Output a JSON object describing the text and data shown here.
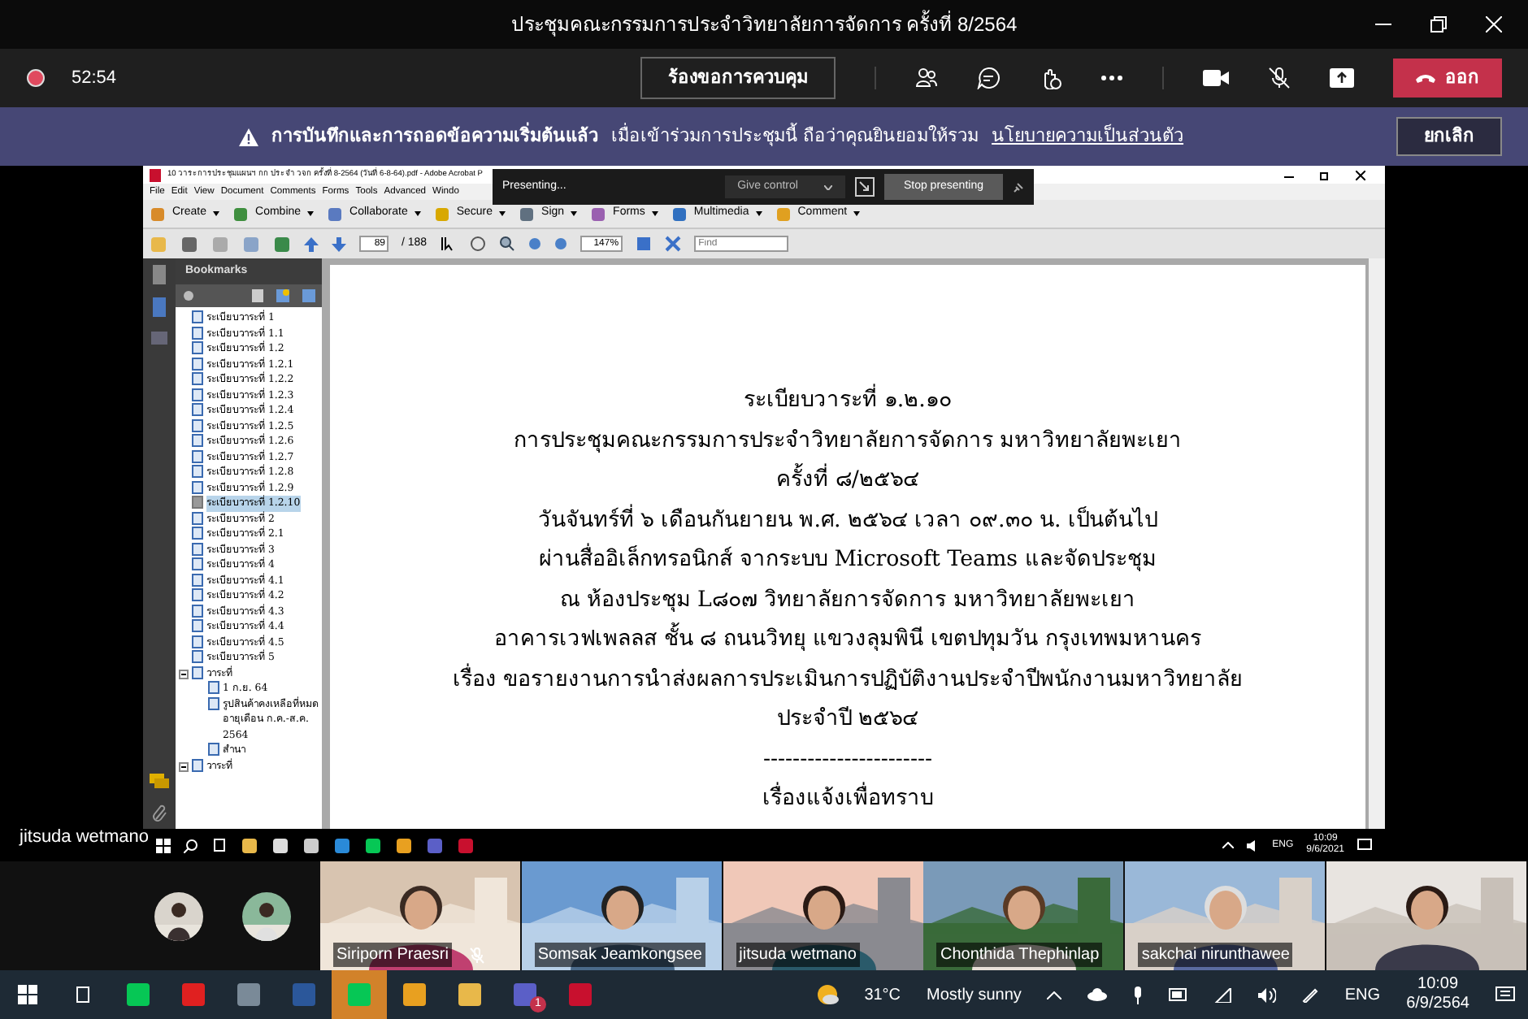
{
  "window": {
    "title": "ประชุมคณะกรรมการประจำวิทยาลัยการจัดการ ครั้งที่ 8/2564"
  },
  "meeting": {
    "recording": true,
    "timer": "52:54",
    "request_control": "ร้องขอการควบคุม",
    "leave": "ออก"
  },
  "banner": {
    "title": "การบันทึกและการถอดข้อความเริ่มต้นแล้ว",
    "message": "เมื่อเข้าร่วมการประชุมนี้ ถือว่าคุณยินยอมให้รวม",
    "link": "นโยบายความเป็นส่วนตัว",
    "button": "ยกเลิก"
  },
  "shared_screen": {
    "presenting_bar": {
      "status": "Presenting...",
      "give_control": "Give control",
      "stop": "Stop presenting"
    },
    "acrobat": {
      "title": "10 วาระการประชุมแผนฯ กก ประจำ วจก ครั้งที่ 8-2564 (วันที่ 6-8-64).pdf - Adobe Acrobat P",
      "menu": [
        "File",
        "Edit",
        "View",
        "Document",
        "Comments",
        "Forms",
        "Tools",
        "Advanced",
        "Windo"
      ],
      "tools": [
        "Create",
        "Combine",
        "Collaborate",
        "Secure",
        "Sign",
        "Forms",
        "Multimedia",
        "Comment"
      ],
      "page": "89",
      "pages": "/ 188",
      "zoom": "147%",
      "find_placeholder": "Find",
      "bookmarks_title": "Bookmarks",
      "bookmarks": [
        {
          "label": "ระเบียบวาระที่ 1",
          "selected": false
        },
        {
          "label": "ระเบียบวาระที่ 1.1",
          "selected": false
        },
        {
          "label": "ระเบียบวาระที่ 1.2",
          "selected": false
        },
        {
          "label": "ระเบียบวาระที่ 1.2.1",
          "selected": false
        },
        {
          "label": "ระเบียบวาระที่ 1.2.2",
          "selected": false
        },
        {
          "label": "ระเบียบวาระที่ 1.2.3",
          "selected": false
        },
        {
          "label": "ระเบียบวาระที่ 1.2.4",
          "selected": false
        },
        {
          "label": "ระเบียบวาระที่ 1.2.5",
          "selected": false
        },
        {
          "label": "ระเบียบวาระที่ 1.2.6",
          "selected": false
        },
        {
          "label": "ระเบียบวาระที่ 1.2.7",
          "selected": false
        },
        {
          "label": "ระเบียบวาระที่ 1.2.8",
          "selected": false
        },
        {
          "label": "ระเบียบวาระที่ 1.2.9",
          "selected": false
        },
        {
          "label": "ระเบียบวาระที่ 1.2.10",
          "selected": true
        },
        {
          "label": "ระเบียบวาระที่ 2",
          "selected": false
        },
        {
          "label": "ระเบียบวาระที่ 2.1",
          "selected": false
        },
        {
          "label": "ระเบียบวาระที่ 3",
          "selected": false
        },
        {
          "label": "ระเบียบวาระที่ 4",
          "selected": false
        },
        {
          "label": "ระเบียบวาระที่ 4.1",
          "selected": false
        },
        {
          "label": "ระเบียบวาระที่ 4.2",
          "selected": false
        },
        {
          "label": "ระเบียบวาระที่ 4.3",
          "selected": false
        },
        {
          "label": "ระเบียบวาระที่ 4.4",
          "selected": false
        },
        {
          "label": "ระเบียบวาระที่ 4.5",
          "selected": false
        },
        {
          "label": "ระเบียบวาระที่ 5",
          "selected": false
        },
        {
          "label": "วาระที่",
          "selected": false,
          "expanded": true,
          "children": [
            {
              "label": "1 ก.ย. 64",
              "selected": false
            },
            {
              "label": "รูปสินค้าคงเหลือที่หมดอายุเดือน ก.ค.-ส.ค. 2564",
              "selected": false
            },
            {
              "label": "สำนา",
              "selected": false
            }
          ]
        },
        {
          "label": "วาระที่",
          "selected": false,
          "expanded": true
        }
      ],
      "document_lines": [
        "ระเบียบวาระที่ ๑.๒.๑๐",
        "การประชุมคณะกรรมการประจำวิทยาลัยการจัดการ มหาวิทยาลัยพะเยา",
        "ครั้งที่ ๘/๒๕๖๔",
        "วันจันทร์ที่ ๖ เดือนกันยายน พ.ศ. ๒๕๖๔ เวลา ๐๙.๓๐ น. เป็นต้นไป",
        "ผ่านสื่ออิเล็กทรอนิกส์ จากระบบ Microsoft Teams และจัดประชุม",
        "ณ ห้องประชุม L๘๐๗ วิทยาลัยการจัดการ มหาวิทยาลัยพะเยา",
        "อาคารเวฟเพลลส ชั้น ๘ ถนนวิทยุ แขวงลุมพินี เขตปทุมวัน กรุงเทพมหานคร",
        "เรื่อง ขอรายงานการนำส่งผลการประเมินการปฏิบัติงานประจำปีพนักงานมหาวิทยาลัย",
        "ประจำปี ๒๕๖๔",
        "-----------------------",
        "เรื่องแจ้งเพื่อทราบ"
      ]
    },
    "taskbar": {
      "lang": "ENG",
      "time": "10:09",
      "date": "9/6/2021"
    }
  },
  "presenter": "jitsuda wetmano",
  "participants": [
    {
      "name": "Siriporn Praesri",
      "muted": true
    },
    {
      "name": "Somsak Jeamkongsee",
      "muted": false
    },
    {
      "name": "jitsuda wetmano",
      "muted": false
    },
    {
      "name": "Chonthida Thephinlap",
      "muted": false
    },
    {
      "name": "sakchai nirunthawee",
      "muted": false
    },
    {
      "muted": false
    }
  ],
  "taskbar": {
    "teams_badge": "1",
    "temperature": "31°C",
    "weather": "Mostly sunny",
    "lang": "ENG",
    "time": "10:09",
    "date": "6/9/2564"
  }
}
